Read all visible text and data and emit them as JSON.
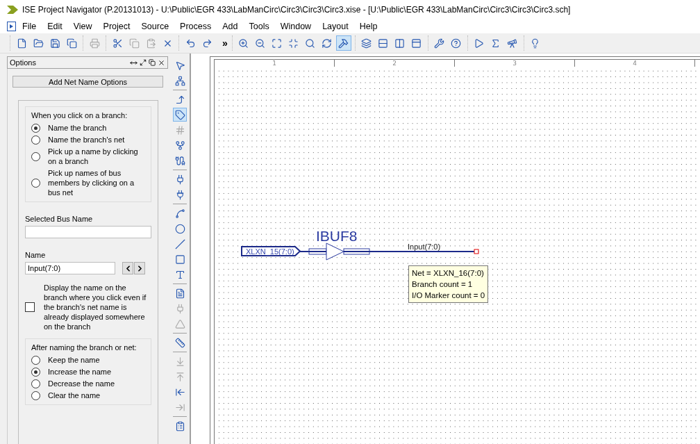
{
  "window": {
    "title": "ISE Project Navigator (P.20131013) - U:\\Public\\EGR 433\\LabManCirc\\Circ3\\Circ3\\Circ3.xise - [U:\\Public\\EGR 433\\LabManCirc\\Circ3\\Circ3\\Circ3.sch]"
  },
  "menu": [
    {
      "label": "File"
    },
    {
      "label": "Edit"
    },
    {
      "label": "View"
    },
    {
      "label": "Project"
    },
    {
      "label": "Source"
    },
    {
      "label": "Process"
    },
    {
      "label": "Add"
    },
    {
      "label": "Tools"
    },
    {
      "label": "Window"
    },
    {
      "label": "Layout"
    },
    {
      "label": "Help"
    }
  ],
  "toolbar": {
    "left_groups": [
      [
        {
          "selected": false,
          "disabled": false
        },
        {
          "selected": false,
          "disabled": false
        },
        {
          "selected": false,
          "disabled": false
        },
        {
          "selected": false,
          "disabled": false
        }
      ],
      [
        {
          "selected": false,
          "disabled": true
        }
      ],
      [
        {
          "selected": false,
          "disabled": false
        },
        {
          "selected": false,
          "disabled": true
        },
        {
          "selected": false,
          "disabled": true
        },
        {
          "selected": false,
          "disabled": false
        }
      ],
      [
        {
          "selected": false,
          "disabled": false
        },
        {
          "selected": false,
          "disabled": false
        }
      ]
    ],
    "overflow": "»",
    "right_groups": [
      [
        {
          "selected": false,
          "disabled": false
        },
        {
          "selected": false,
          "disabled": false
        },
        {
          "selected": false,
          "disabled": false
        },
        {
          "selected": false,
          "disabled": false
        },
        {
          "selected": false,
          "disabled": false
        },
        {
          "selected": false,
          "disabled": false
        },
        {
          "selected": true,
          "disabled": false
        }
      ],
      [
        {
          "selected": false,
          "disabled": false
        },
        {
          "selected": false,
          "disabled": false
        },
        {
          "selected": false,
          "disabled": false
        },
        {
          "selected": false,
          "disabled": false
        }
      ],
      [
        {
          "selected": false,
          "disabled": false
        },
        {
          "selected": false,
          "disabled": false
        }
      ],
      [
        {
          "selected": false,
          "disabled": false
        },
        {
          "selected": false,
          "disabled": false
        },
        {
          "selected": false,
          "disabled": false
        }
      ],
      [
        {
          "selected": false,
          "disabled": false
        }
      ]
    ]
  },
  "options_panel": {
    "title": "Options",
    "header_button": "Add Net Name Options",
    "branch_group": {
      "heading": "When you click on a branch:",
      "options": [
        {
          "label": "Name the branch",
          "selected": true
        },
        {
          "label": "Name the branch's net",
          "selected": false
        },
        {
          "label": "Pick up a name by clicking on a branch",
          "selected": false
        },
        {
          "label": "Pick up names of bus members by clicking on a bus net",
          "selected": false
        }
      ]
    },
    "selected_bus_name": {
      "label": "Selected Bus Name"
    },
    "name_field": {
      "label": "Name",
      "value": "Input(7:0)"
    },
    "display_checkbox": {
      "label": "Display the name on the branch where you click even if the branch's net name is already displayed somewhere on the branch",
      "checked": false
    },
    "after_group": {
      "heading": "After naming the branch or net:",
      "options": [
        {
          "label": "Keep the name",
          "selected": false
        },
        {
          "label": "Increase the name",
          "selected": true
        },
        {
          "label": "Decrease the name",
          "selected": false
        },
        {
          "label": "Clear the name",
          "selected": false
        }
      ]
    }
  },
  "tool_palette": {
    "groups": [
      [
        {
          "selected": false,
          "disabled": false
        },
        {
          "selected": false,
          "disabled": false
        }
      ],
      [
        {
          "selected": false,
          "disabled": false
        },
        {
          "selected": true,
          "disabled": false
        },
        {
          "selected": false,
          "disabled": true
        },
        {
          "selected": false,
          "disabled": false
        },
        {
          "selected": false,
          "disabled": false
        }
      ],
      [
        {
          "selected": false,
          "disabled": false
        },
        {
          "selected": false,
          "disabled": false
        }
      ],
      [
        {
          "selected": false,
          "disabled": false
        },
        {
          "selected": false,
          "disabled": false
        },
        {
          "selected": false,
          "disabled": false
        },
        {
          "selected": false,
          "disabled": false
        },
        {
          "selected": false,
          "disabled": false
        }
      ],
      [
        {
          "selected": false,
          "disabled": false
        },
        {
          "selected": false,
          "disabled": true
        },
        {
          "selected": false,
          "disabled": true
        }
      ],
      [
        {
          "selected": false,
          "disabled": false
        }
      ],
      [
        {
          "selected": false,
          "disabled": true
        },
        {
          "selected": false,
          "disabled": true
        },
        {
          "selected": false,
          "disabled": false
        },
        {
          "selected": false,
          "disabled": true
        }
      ],
      [
        {
          "selected": false,
          "disabled": false
        }
      ]
    ]
  },
  "schematic": {
    "ruler": [
      "1",
      "2",
      "3",
      "4"
    ],
    "io_marker": "XLXN_15(7:0)",
    "symbol": "IBUF8",
    "net_label": "Input(7:0)",
    "tooltip": [
      "Net = XLXN_16(7:0)",
      "Branch count = 1",
      "I/O Marker count = 0"
    ]
  }
}
